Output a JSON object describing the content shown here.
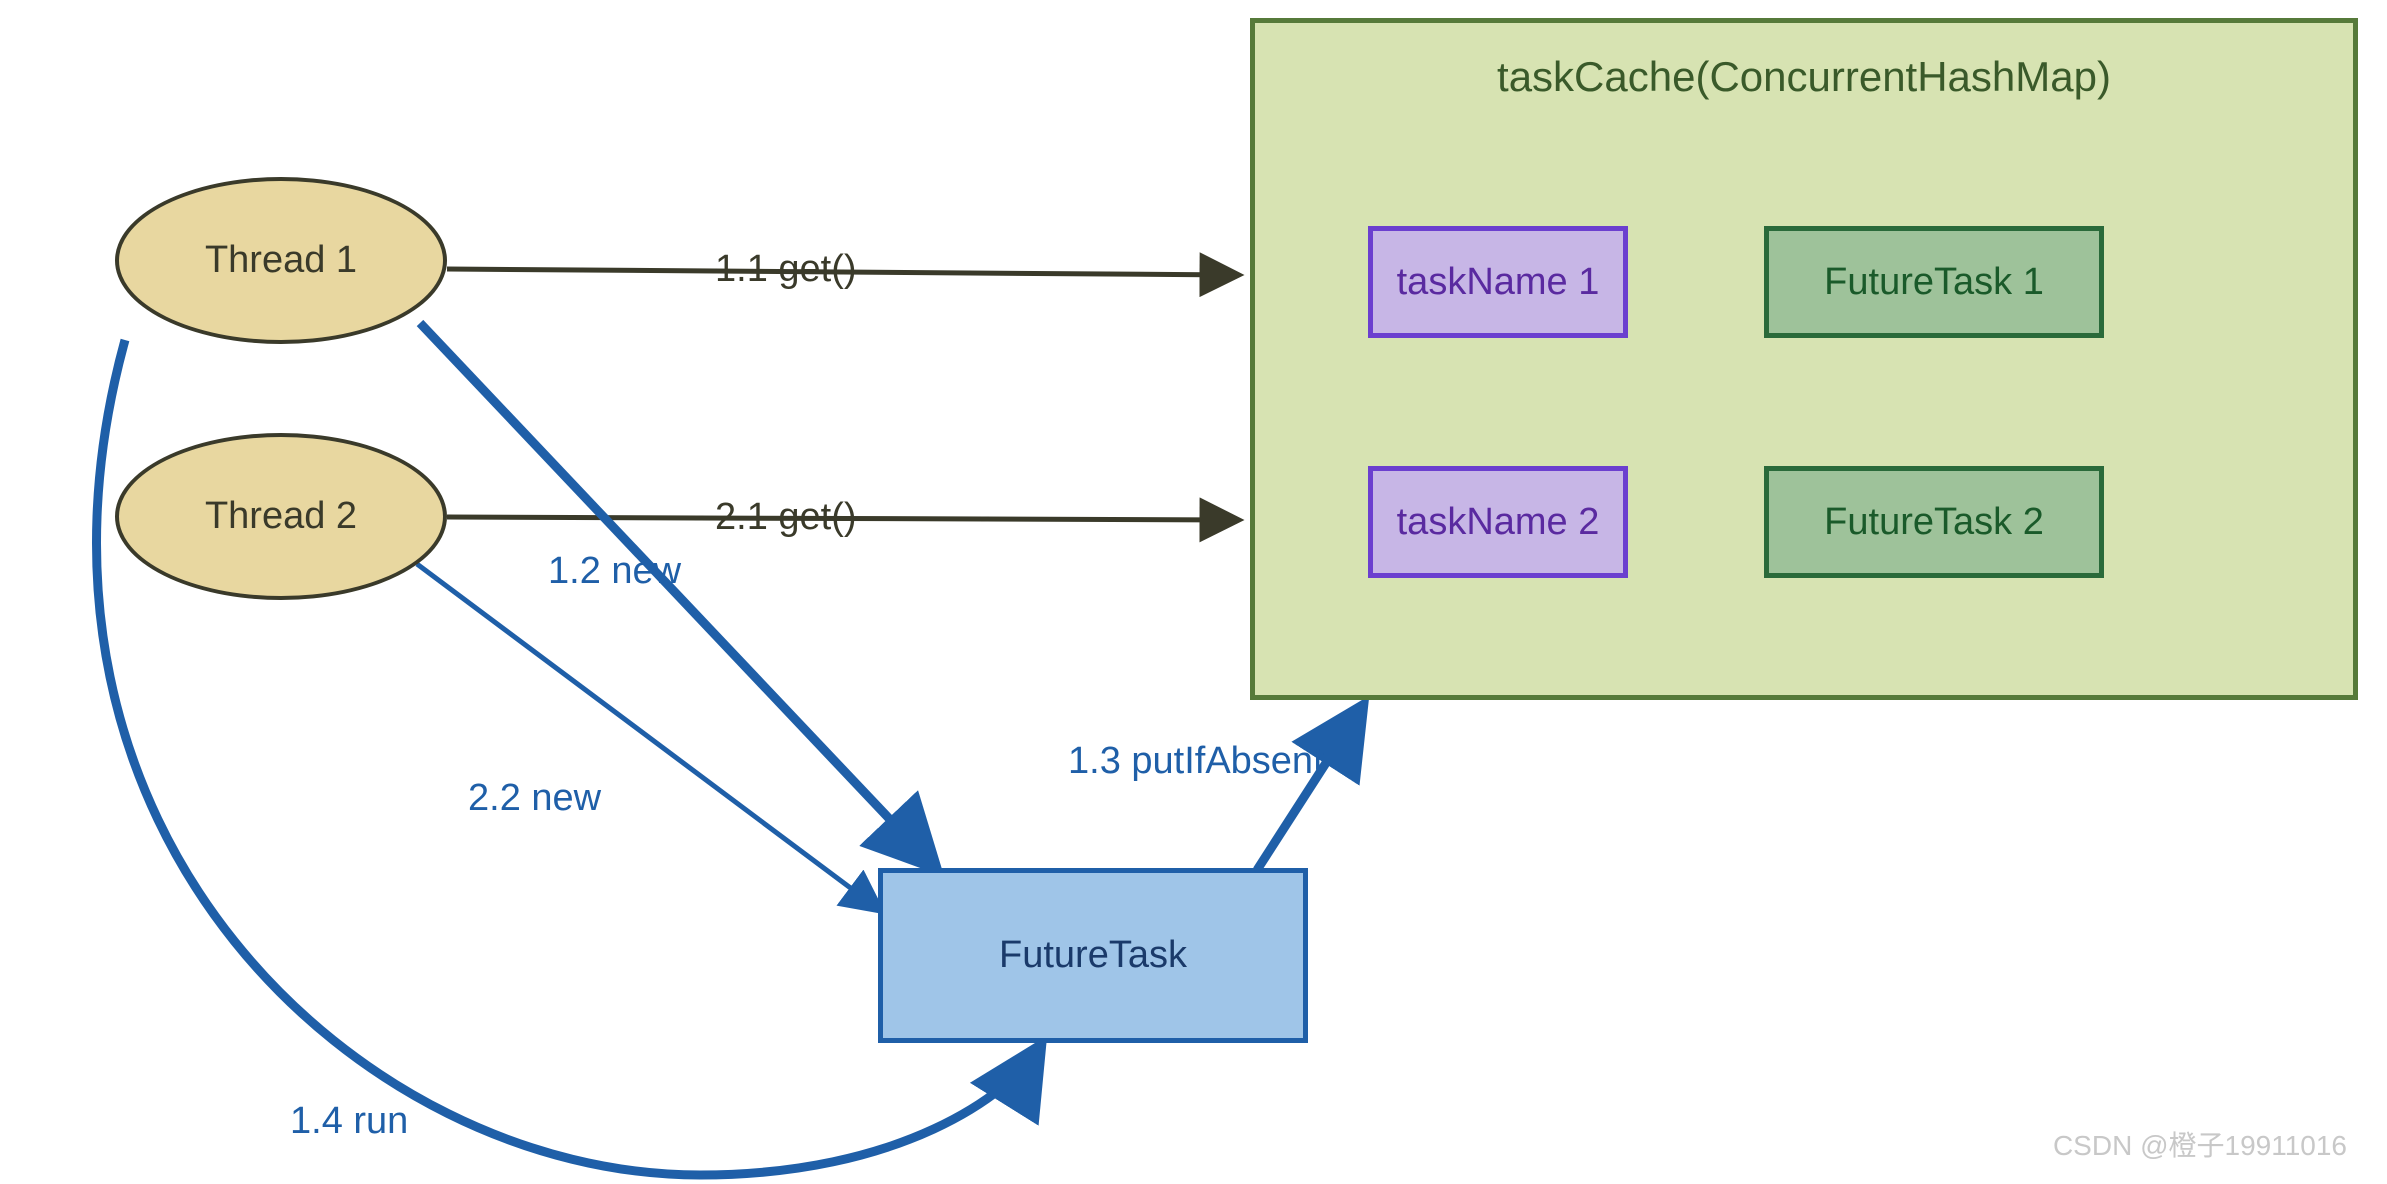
{
  "nodes": {
    "thread1": "Thread 1",
    "thread2": "Thread 2",
    "futureTask": "FutureTask",
    "cacheTitle": "taskCache(ConcurrentHashMap)",
    "taskName1": "taskName 1",
    "futureTask1": "FutureTask 1",
    "taskName2": "taskName 2",
    "futureTask2": "FutureTask 2"
  },
  "edges": {
    "get1": "1.1 get()",
    "new1": "1.2 new",
    "putIfAbsent": "1.3 putIfAbsent",
    "run": "1.4 run",
    "get2": "2.1 get()",
    "new2": "2.2 new"
  },
  "watermark": "CSDN @橙子19911016"
}
